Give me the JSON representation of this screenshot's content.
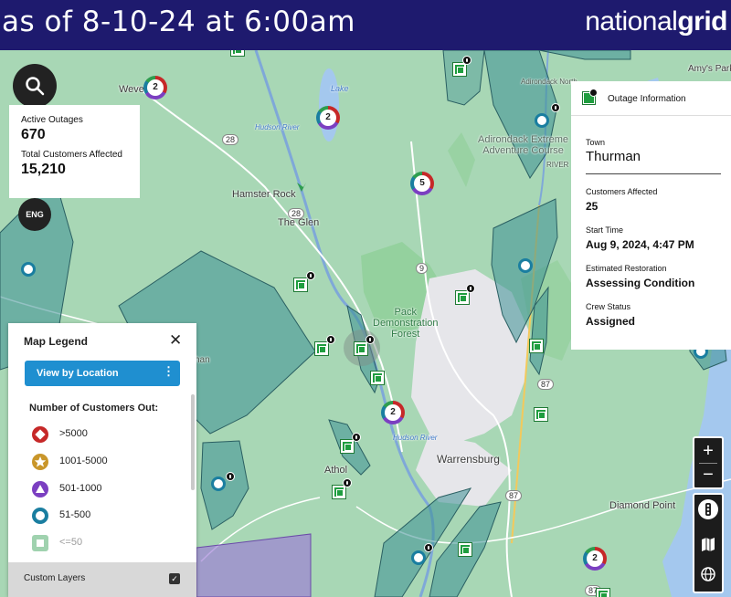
{
  "header": {
    "title": "as of 8-10-24 at 6:00am",
    "brand_light": "national",
    "brand_bold": "grid"
  },
  "stats": {
    "active_outages_label": "Active Outages",
    "active_outages_value": "670",
    "customers_label": "Total Customers Affected",
    "customers_value": "15,210"
  },
  "lang_button": "ENG",
  "legend": {
    "title": "Map Legend",
    "view_button": "View by Location",
    "heading": "Number of Customers Out:",
    "items": [
      {
        "label": ">5000",
        "color": "#c62828",
        "shape": "diamond"
      },
      {
        "label": "1001-5000",
        "color": "#c9962a",
        "shape": "star"
      },
      {
        "label": "501-1000",
        "color": "#7b3fc1",
        "shape": "triangle"
      },
      {
        "label": "51-500",
        "color": "#1a7ea0",
        "shape": "circle"
      },
      {
        "label": "<=50",
        "color": "#2e9d4f",
        "shape": "square"
      }
    ],
    "custom_layers": "Custom Layers"
  },
  "outage_panel": {
    "title": "Outage Information",
    "town_label": "Town",
    "town_value": "Thurman",
    "customers_label": "Customers Affected",
    "customers_value": "25",
    "start_label": "Start Time",
    "start_value": "Aug 9, 2024, 4:47 PM",
    "restoration_label": "Estimated Restoration",
    "restoration_value": "Assessing Condition",
    "crew_label": "Crew Status",
    "crew_value": "Assigned"
  },
  "map": {
    "places": {
      "weve": "Weve",
      "hamster_rock": "Hamster Rock",
      "the_glen": "The Glen",
      "pack_forest": "Pack\nDemonstration\nForest",
      "warrensburg": "Warrensburg",
      "athol": "Athol",
      "diamond_point": "Diamond Point",
      "amys_park": "Amy's Park",
      "adirondack": "Adirondack Extreme\nAdventure Course",
      "river": "RIVER",
      "lake": "Lake",
      "hudson_river": "Hudson River",
      "hudson_river_2": "Hudson River",
      "fragment_han": "han",
      "adirondack_north": "Adirondack North"
    },
    "routes": {
      "r28": "28",
      "r28b": "28",
      "r9": "9",
      "r87": "87",
      "r87b": "87",
      "r87c": "87"
    },
    "clusters": {
      "c1": "2",
      "c2": "2",
      "c3": "5",
      "c4": "2",
      "c5": "2"
    },
    "colors": {
      "outage_area": "#3c8f94",
      "forest": "#8fcf98",
      "water": "#a4c8ee",
      "urban": "#e6e6ea"
    }
  }
}
